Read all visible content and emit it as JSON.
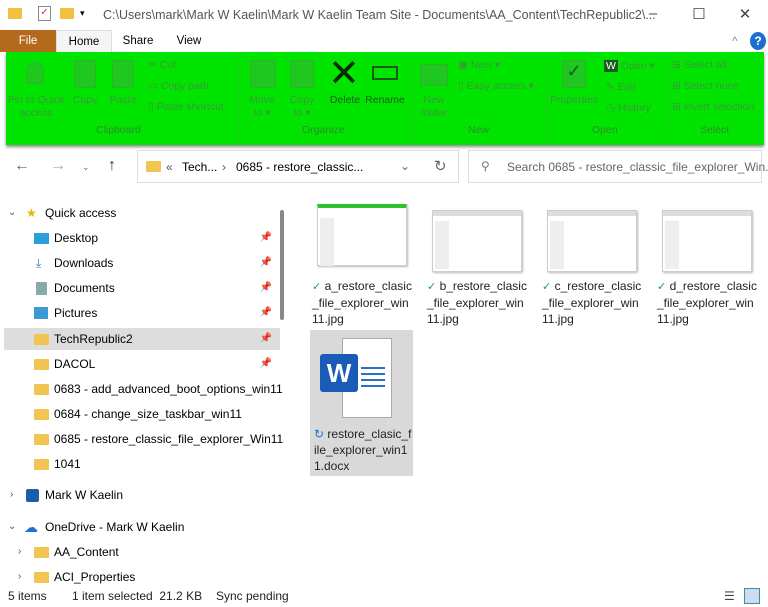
{
  "window": {
    "title": "C:\\Users\\mark\\Mark W Kaelin\\Mark W Kaelin Team Site - Documents\\AA_Content\\TechRepublic2\\...",
    "minimize": "–",
    "maximize": "☐",
    "close": "✕"
  },
  "tabs": [
    "File",
    "Home",
    "Share",
    "View"
  ],
  "ribbon": {
    "clipboard": {
      "pin": "Pin to Quick access",
      "copy": "Copy",
      "paste": "Paste",
      "cut": "Cut",
      "copy_path": "Copy path",
      "paste_shortcut": "Paste shortcut",
      "label": "Clipboard"
    },
    "organize": {
      "move_to": "Move to ▾",
      "copy_to": "Copy to ▾",
      "delete": "Delete",
      "rename": "Rename",
      "label": "Organize"
    },
    "new": {
      "new_folder": "New folder",
      "new_item": "New ▾",
      "easy_access": "Easy access ▾",
      "label": "New"
    },
    "open": {
      "properties": "Properties",
      "open": "Open ▾",
      "edit": "Edit",
      "history": "History",
      "label": "Open"
    },
    "select": {
      "select_all": "Select all",
      "select_none": "Select none",
      "invert": "Invert selection",
      "label": "Select"
    },
    "accent": "#00e400"
  },
  "address": {
    "prefix": "«",
    "crumb1": "Tech...",
    "crumb2": "0685 - restore_classic...",
    "search_placeholder": "Search 0685 - restore_classic_file_explorer_Win..."
  },
  "nav": {
    "quick_access": "Quick access",
    "items": [
      "Desktop",
      "Downloads",
      "Documents",
      "Pictures",
      "TechRepublic2",
      "DACOL",
      "0683 - add_advanced_boot_options_win11",
      "0684 - change_size_taskbar_win11",
      "0685 - restore_classic_file_explorer_Win11",
      "1041"
    ],
    "mark": "Mark W Kaelin",
    "onedrive": "OneDrive - Mark W Kaelin",
    "od_items": [
      "AA_Content",
      "ACI_Properties"
    ]
  },
  "files": [
    {
      "name": "a_restore_clasic_file_explorer_win11.jpg"
    },
    {
      "name": "b_restore_clasic_file_explorer_win11.jpg"
    },
    {
      "name": "c_restore_clasic_file_explorer_win11.jpg"
    },
    {
      "name": "d_restore_clasic_file_explorer_win11.jpg"
    },
    {
      "name": "restore_clasic_file_explorer_win11.docx"
    }
  ],
  "status": {
    "count": "5 items",
    "selected": "1 item selected  21.2 KB",
    "sync": "Sync pending"
  }
}
